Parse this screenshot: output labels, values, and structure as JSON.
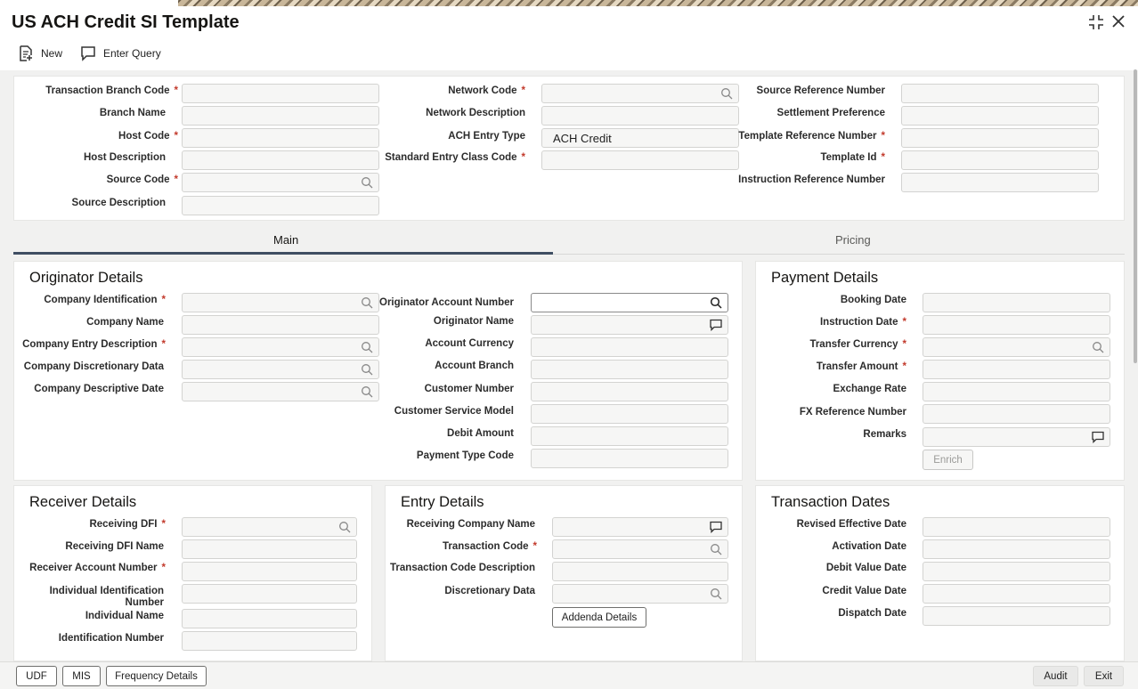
{
  "window": {
    "title": "US ACH Credit SI Template"
  },
  "toolbar": {
    "new_label": "New",
    "enter_query_label": "Enter Query"
  },
  "header": {
    "col1": [
      {
        "label": "Transaction Branch Code",
        "value": "",
        "required": true
      },
      {
        "label": "Branch Name",
        "value": ""
      },
      {
        "label": "Host Code",
        "value": "",
        "required": true
      },
      {
        "label": "Host Description",
        "value": ""
      },
      {
        "label": "Source Code",
        "value": "",
        "required": true
      },
      {
        "label": "Source Description",
        "value": ""
      }
    ],
    "col2": [
      {
        "label": "Network Code",
        "value": "",
        "required": true
      },
      {
        "label": "Network Description",
        "value": ""
      },
      {
        "label": "ACH Entry Type",
        "value": "ACH Credit"
      },
      {
        "label": "Standard Entry Class Code",
        "value": "",
        "required": true
      }
    ],
    "col3": [
      {
        "label": "Source Reference Number",
        "value": ""
      },
      {
        "label": "Settlement Preference",
        "value": ""
      },
      {
        "label": "Template Reference Number",
        "value": "",
        "required": true
      },
      {
        "label": "Template Id",
        "value": "",
        "required": true
      },
      {
        "label": "Instruction Reference Number",
        "value": ""
      }
    ]
  },
  "tabs": [
    {
      "label": "Main",
      "active": true
    },
    {
      "label": "Pricing",
      "active": false
    }
  ],
  "originator": {
    "title": "Originator Details",
    "left": [
      {
        "label": "Company Identification",
        "value": "",
        "required": true
      },
      {
        "label": "Company Name",
        "value": ""
      },
      {
        "label": "Company Entry Description",
        "value": "",
        "required": true
      },
      {
        "label": "Company Discretionary Data",
        "value": ""
      },
      {
        "label": "Company Descriptive Date",
        "value": ""
      }
    ],
    "right": [
      {
        "label": "Originator Account Number",
        "value": ""
      },
      {
        "label": "Originator Name",
        "value": ""
      },
      {
        "label": "Account Currency",
        "value": ""
      },
      {
        "label": "Account Branch",
        "value": ""
      },
      {
        "label": "Customer Number",
        "value": ""
      },
      {
        "label": "Customer Service Model",
        "value": ""
      },
      {
        "label": "Debit Amount",
        "value": ""
      },
      {
        "label": "Payment Type Code",
        "value": ""
      }
    ]
  },
  "payment": {
    "title": "Payment Details",
    "fields": [
      {
        "label": "Booking Date",
        "value": ""
      },
      {
        "label": "Instruction Date",
        "value": "",
        "required": true
      },
      {
        "label": "Transfer Currency",
        "value": "",
        "required": true
      },
      {
        "label": "Transfer Amount",
        "value": "",
        "required": true
      },
      {
        "label": "Exchange Rate",
        "value": ""
      },
      {
        "label": "FX Reference Number",
        "value": ""
      },
      {
        "label": "Remarks",
        "value": ""
      }
    ],
    "enrich_label": "Enrich"
  },
  "receiver": {
    "title": "Receiver Details",
    "fields": [
      {
        "label": "Receiving DFI",
        "value": "",
        "required": true
      },
      {
        "label": "Receiving DFI Name",
        "value": ""
      },
      {
        "label": "Receiver Account Number",
        "value": "",
        "required": true
      },
      {
        "label": "Individual Identification Number",
        "value": ""
      },
      {
        "label": "Individual Name",
        "value": ""
      },
      {
        "label": "Identification Number",
        "value": ""
      }
    ]
  },
  "entry": {
    "title": "Entry Details",
    "fields": [
      {
        "label": "Receiving Company Name",
        "value": ""
      },
      {
        "label": "Transaction Code",
        "value": "",
        "required": true
      },
      {
        "label": "Transaction Code Description",
        "value": ""
      },
      {
        "label": "Discretionary Data",
        "value": ""
      }
    ],
    "addenda_label": "Addenda Details"
  },
  "dates": {
    "title": "Transaction Dates",
    "fields": [
      {
        "label": "Revised Effective Date",
        "value": ""
      },
      {
        "label": "Activation Date",
        "value": ""
      },
      {
        "label": "Debit Value Date",
        "value": ""
      },
      {
        "label": "Credit Value Date",
        "value": ""
      },
      {
        "label": "Dispatch Date",
        "value": ""
      }
    ]
  },
  "footer": {
    "udf_label": "UDF",
    "mis_label": "MIS",
    "frequency_label": "Frequency Details",
    "audit_label": "Audit",
    "exit_label": "Exit"
  },
  "colors": {
    "accent": "#3f4e63",
    "required": "#c2392b"
  }
}
